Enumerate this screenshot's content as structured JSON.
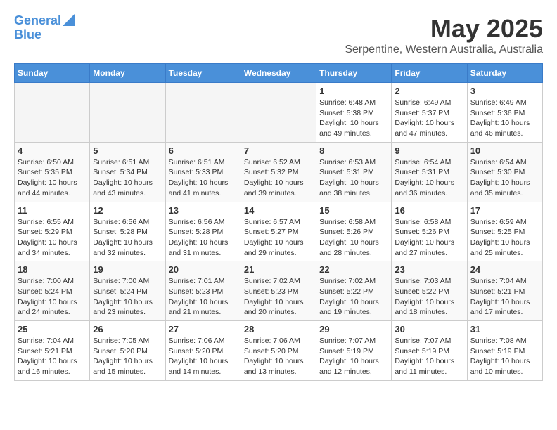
{
  "header": {
    "logo_line1": "General",
    "logo_line2": "Blue",
    "month_title": "May 2025",
    "location": "Serpentine, Western Australia, Australia"
  },
  "days_of_week": [
    "Sunday",
    "Monday",
    "Tuesday",
    "Wednesday",
    "Thursday",
    "Friday",
    "Saturday"
  ],
  "weeks": [
    {
      "days": [
        {
          "num": "",
          "info": ""
        },
        {
          "num": "",
          "info": ""
        },
        {
          "num": "",
          "info": ""
        },
        {
          "num": "",
          "info": ""
        },
        {
          "num": "1",
          "info": "Sunrise: 6:48 AM\nSunset: 5:38 PM\nDaylight: 10 hours\nand 49 minutes."
        },
        {
          "num": "2",
          "info": "Sunrise: 6:49 AM\nSunset: 5:37 PM\nDaylight: 10 hours\nand 47 minutes."
        },
        {
          "num": "3",
          "info": "Sunrise: 6:49 AM\nSunset: 5:36 PM\nDaylight: 10 hours\nand 46 minutes."
        }
      ]
    },
    {
      "days": [
        {
          "num": "4",
          "info": "Sunrise: 6:50 AM\nSunset: 5:35 PM\nDaylight: 10 hours\nand 44 minutes."
        },
        {
          "num": "5",
          "info": "Sunrise: 6:51 AM\nSunset: 5:34 PM\nDaylight: 10 hours\nand 43 minutes."
        },
        {
          "num": "6",
          "info": "Sunrise: 6:51 AM\nSunset: 5:33 PM\nDaylight: 10 hours\nand 41 minutes."
        },
        {
          "num": "7",
          "info": "Sunrise: 6:52 AM\nSunset: 5:32 PM\nDaylight: 10 hours\nand 39 minutes."
        },
        {
          "num": "8",
          "info": "Sunrise: 6:53 AM\nSunset: 5:31 PM\nDaylight: 10 hours\nand 38 minutes."
        },
        {
          "num": "9",
          "info": "Sunrise: 6:54 AM\nSunset: 5:31 PM\nDaylight: 10 hours\nand 36 minutes."
        },
        {
          "num": "10",
          "info": "Sunrise: 6:54 AM\nSunset: 5:30 PM\nDaylight: 10 hours\nand 35 minutes."
        }
      ]
    },
    {
      "days": [
        {
          "num": "11",
          "info": "Sunrise: 6:55 AM\nSunset: 5:29 PM\nDaylight: 10 hours\nand 34 minutes."
        },
        {
          "num": "12",
          "info": "Sunrise: 6:56 AM\nSunset: 5:28 PM\nDaylight: 10 hours\nand 32 minutes."
        },
        {
          "num": "13",
          "info": "Sunrise: 6:56 AM\nSunset: 5:28 PM\nDaylight: 10 hours\nand 31 minutes."
        },
        {
          "num": "14",
          "info": "Sunrise: 6:57 AM\nSunset: 5:27 PM\nDaylight: 10 hours\nand 29 minutes."
        },
        {
          "num": "15",
          "info": "Sunrise: 6:58 AM\nSunset: 5:26 PM\nDaylight: 10 hours\nand 28 minutes."
        },
        {
          "num": "16",
          "info": "Sunrise: 6:58 AM\nSunset: 5:26 PM\nDaylight: 10 hours\nand 27 minutes."
        },
        {
          "num": "17",
          "info": "Sunrise: 6:59 AM\nSunset: 5:25 PM\nDaylight: 10 hours\nand 25 minutes."
        }
      ]
    },
    {
      "days": [
        {
          "num": "18",
          "info": "Sunrise: 7:00 AM\nSunset: 5:24 PM\nDaylight: 10 hours\nand 24 minutes."
        },
        {
          "num": "19",
          "info": "Sunrise: 7:00 AM\nSunset: 5:24 PM\nDaylight: 10 hours\nand 23 minutes."
        },
        {
          "num": "20",
          "info": "Sunrise: 7:01 AM\nSunset: 5:23 PM\nDaylight: 10 hours\nand 21 minutes."
        },
        {
          "num": "21",
          "info": "Sunrise: 7:02 AM\nSunset: 5:23 PM\nDaylight: 10 hours\nand 20 minutes."
        },
        {
          "num": "22",
          "info": "Sunrise: 7:02 AM\nSunset: 5:22 PM\nDaylight: 10 hours\nand 19 minutes."
        },
        {
          "num": "23",
          "info": "Sunrise: 7:03 AM\nSunset: 5:22 PM\nDaylight: 10 hours\nand 18 minutes."
        },
        {
          "num": "24",
          "info": "Sunrise: 7:04 AM\nSunset: 5:21 PM\nDaylight: 10 hours\nand 17 minutes."
        }
      ]
    },
    {
      "days": [
        {
          "num": "25",
          "info": "Sunrise: 7:04 AM\nSunset: 5:21 PM\nDaylight: 10 hours\nand 16 minutes."
        },
        {
          "num": "26",
          "info": "Sunrise: 7:05 AM\nSunset: 5:20 PM\nDaylight: 10 hours\nand 15 minutes."
        },
        {
          "num": "27",
          "info": "Sunrise: 7:06 AM\nSunset: 5:20 PM\nDaylight: 10 hours\nand 14 minutes."
        },
        {
          "num": "28",
          "info": "Sunrise: 7:06 AM\nSunset: 5:20 PM\nDaylight: 10 hours\nand 13 minutes."
        },
        {
          "num": "29",
          "info": "Sunrise: 7:07 AM\nSunset: 5:19 PM\nDaylight: 10 hours\nand 12 minutes."
        },
        {
          "num": "30",
          "info": "Sunrise: 7:07 AM\nSunset: 5:19 PM\nDaylight: 10 hours\nand 11 minutes."
        },
        {
          "num": "31",
          "info": "Sunrise: 7:08 AM\nSunset: 5:19 PM\nDaylight: 10 hours\nand 10 minutes."
        }
      ]
    }
  ]
}
